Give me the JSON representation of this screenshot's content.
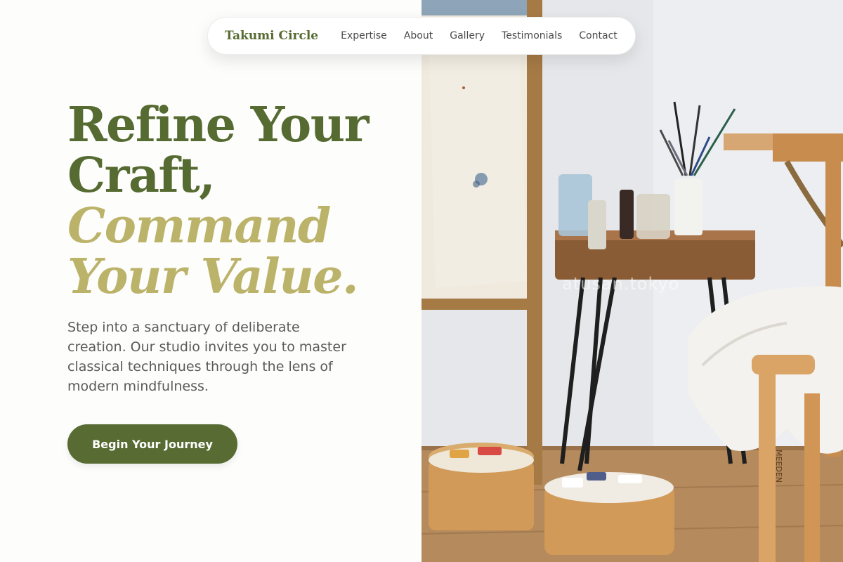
{
  "nav": {
    "brand": "Takumi Circle",
    "links": [
      "Expertise",
      "About",
      "Gallery",
      "Testimonials",
      "Contact"
    ]
  },
  "hero": {
    "headline_line1": "Refine Your",
    "headline_line2": "Craft,",
    "headline_line3": "Command",
    "headline_line4": "Your Value.",
    "subcopy": "Step into a sanctuary of deliberate creation. Our studio invites you to master classical techniques through the lens of modern mindfulness.",
    "cta_label": "Begin Your Journey"
  },
  "photo": {
    "watermark": "atusan.tokyo",
    "stool_text": "MEEDEN"
  },
  "colors": {
    "accent_dark": "#566b31",
    "accent_light": "#bcb36a",
    "body_text": "#5a5a5a"
  }
}
